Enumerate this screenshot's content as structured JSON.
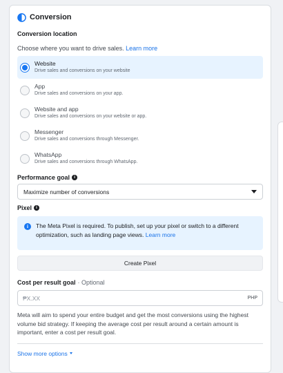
{
  "header": {
    "title": "Conversion",
    "icon": "half-contrast-icon"
  },
  "conversion_location": {
    "label": "Conversion location",
    "prompt": "Choose where you want to drive sales.",
    "learn_more": "Learn more",
    "options": [
      {
        "title": "Website",
        "desc": "Drive sales and conversions on your website",
        "selected": true
      },
      {
        "title": "App",
        "desc": "Drive sales and conversions on your app.",
        "selected": false
      },
      {
        "title": "Website and app",
        "desc": "Drive sales and conversions on your website or app.",
        "selected": false
      },
      {
        "title": "Messenger",
        "desc": "Drive sales and conversions through Messenger.",
        "selected": false
      },
      {
        "title": "WhatsApp",
        "desc": "Drive sales and conversions through WhatsApp.",
        "selected": false
      }
    ]
  },
  "performance_goal": {
    "label": "Performance goal",
    "selected": "Maximize number of conversions"
  },
  "pixel": {
    "label": "Pixel",
    "notice": "The Meta Pixel is required. To publish, set up your pixel or switch to a different optimization, such as landing page views.",
    "notice_link": "Learn more",
    "create_button": "Create Pixel"
  },
  "cost_per_result": {
    "label": "Cost per result goal",
    "optional": "· Optional",
    "placeholder": "₱X.XX",
    "currency": "PHP",
    "help": "Meta will aim to spend your entire budget and get the most conversions using the highest volume bid strategy. If keeping the average cost per result around a certain amount is important, enter a cost per result goal."
  },
  "show_more": "Show more options",
  "colors": {
    "accent": "#1877f2",
    "link": "#1a73e8",
    "selected_bg": "#e7f3ff"
  }
}
